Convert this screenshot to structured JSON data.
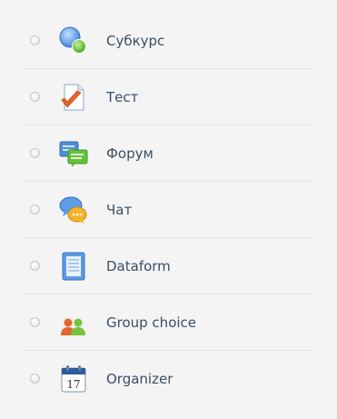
{
  "activities": [
    {
      "label": "Субкурс",
      "icon": "subcourse-icon"
    },
    {
      "label": "Тест",
      "icon": "quiz-icon"
    },
    {
      "label": "Форум",
      "icon": "forum-icon"
    },
    {
      "label": "Чат",
      "icon": "chat-icon"
    },
    {
      "label": "Dataform",
      "icon": "dataform-icon"
    },
    {
      "label": "Group choice",
      "icon": "group-choice-icon"
    },
    {
      "label": "Organizer",
      "icon": "organizer-icon"
    }
  ],
  "organizer_calendar_day": "17",
  "colors": {
    "label_text": "#3b4d66",
    "background": "#f4f4f4",
    "divider": "#e5e5e5"
  }
}
